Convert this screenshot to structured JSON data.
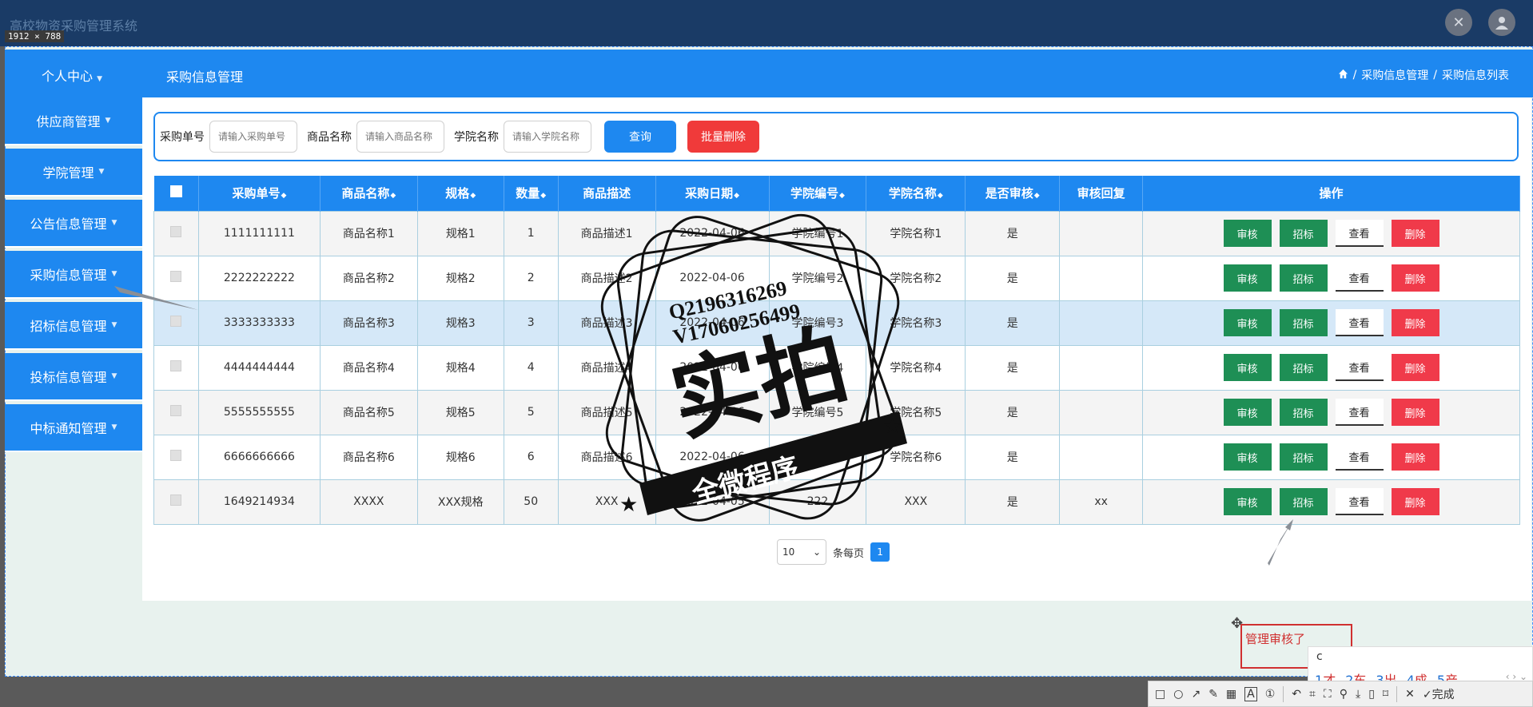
{
  "app_title": "高校物资采购管理系统",
  "capture_dims": "1912 × 788",
  "header": {
    "personal_center": "个人中心",
    "page_title": "采购信息管理",
    "breadcrumb": [
      "采购信息管理",
      "采购信息列表"
    ]
  },
  "sidebar": {
    "items": [
      {
        "label": "供应商管理"
      },
      {
        "label": "学院管理"
      },
      {
        "label": "公告信息管理"
      },
      {
        "label": "采购信息管理"
      },
      {
        "label": "招标信息管理"
      },
      {
        "label": "投标信息管理"
      },
      {
        "label": "中标通知管理"
      }
    ]
  },
  "search": {
    "fields": [
      {
        "label": "采购单号",
        "placeholder": "请输入采购单号"
      },
      {
        "label": "商品名称",
        "placeholder": "请输入商品名称"
      },
      {
        "label": "学院名称",
        "placeholder": "请输入学院名称"
      }
    ],
    "query_label": "查询",
    "batch_delete_label": "批量删除"
  },
  "table": {
    "columns": [
      "采购单号",
      "商品名称",
      "规格",
      "数量",
      "商品描述",
      "采购日期",
      "学院编号",
      "学院名称",
      "是否审核",
      "审核回复",
      "操作"
    ],
    "actions": [
      "审核",
      "招标",
      "查看",
      "删除"
    ],
    "rows": [
      [
        "1111111111",
        "商品名称1",
        "规格1",
        "1",
        "商品描述1",
        "2022-04-06",
        "学院编号1",
        "学院名称1",
        "是",
        ""
      ],
      [
        "2222222222",
        "商品名称2",
        "规格2",
        "2",
        "商品描述2",
        "2022-04-06",
        "学院编号2",
        "学院名称2",
        "是",
        ""
      ],
      [
        "3333333333",
        "商品名称3",
        "规格3",
        "3",
        "商品描述3",
        "2022-04-06",
        "学院编号3",
        "学院名称3",
        "是",
        ""
      ],
      [
        "4444444444",
        "商品名称4",
        "规格4",
        "4",
        "商品描述4",
        "2022-04-06",
        "学院编号4",
        "学院名称4",
        "是",
        ""
      ],
      [
        "5555555555",
        "商品名称5",
        "规格5",
        "5",
        "商品描述5",
        "2022-04-06",
        "学院编号5",
        "学院名称5",
        "是",
        ""
      ],
      [
        "6666666666",
        "商品名称6",
        "规格6",
        "6",
        "商品描述6",
        "2022-04-06",
        "学院编号6",
        "学院名称6",
        "是",
        ""
      ],
      [
        "1649214934",
        "XXXX",
        "XXX规格",
        "50",
        "XXX",
        "2022-04-05",
        "222",
        "XXX",
        "是",
        "xx"
      ]
    ]
  },
  "pager": {
    "page_size": "10",
    "per_page_label": "条每页",
    "current_page": "1"
  },
  "stamp": {
    "line1": "Q2196316269",
    "line2": "V17060256499",
    "main": "实拍",
    "banner": "全微程序"
  },
  "annotation": {
    "text": "管理审核了",
    "ime_input": "c",
    "ime_candidates": [
      {
        "n": "1",
        "c": "才"
      },
      {
        "n": "2",
        "c": "车"
      },
      {
        "n": "3",
        "c": "出"
      },
      {
        "n": "4",
        "c": "成"
      },
      {
        "n": "5",
        "c": "产"
      }
    ],
    "done_label": "完成"
  }
}
